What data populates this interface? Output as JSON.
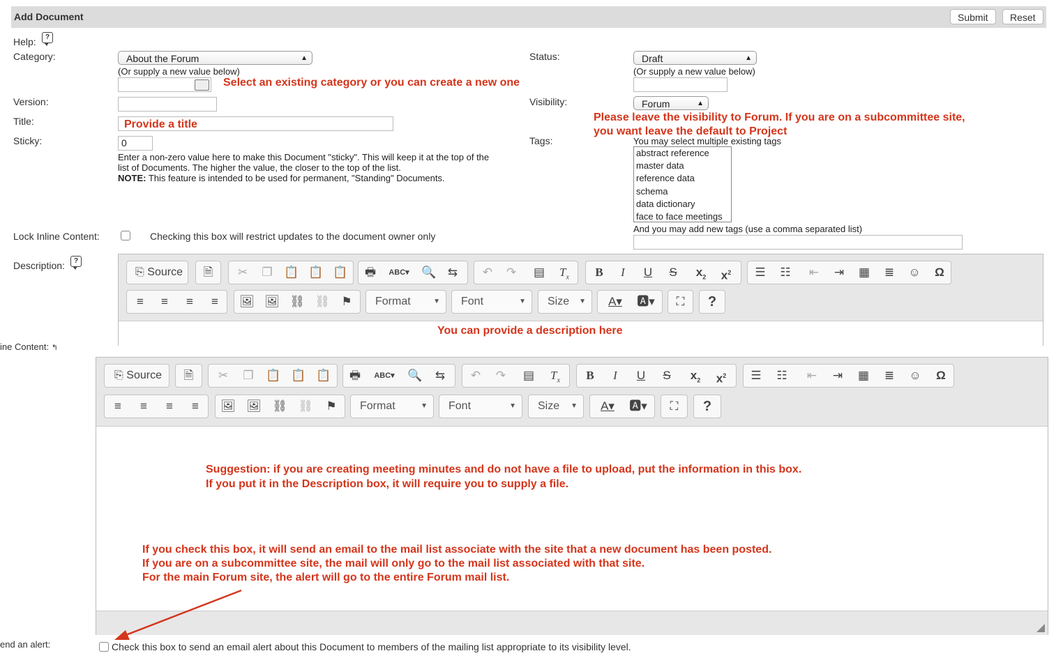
{
  "header": {
    "title": "Add Document",
    "submit_label": "Submit",
    "reset_label": "Reset"
  },
  "form": {
    "help_label": "Help:",
    "category_label": "Category:",
    "category_value": "About the Forum",
    "supply_new_text": "(Or supply a new value below)",
    "version_label": "Version:",
    "title_label": "Title:",
    "sticky_label": "Sticky:",
    "sticky_value": "0",
    "sticky_help_line1": "Enter a non-zero value here to make this Document \"sticky\". This will keep it at the top of the",
    "sticky_help_line2": "list of Documents. The higher the value, the closer to the top of the list.",
    "note_bold": "NOTE:",
    "note_text": " This feature is intended to be used for permanent, \"Standing\" Documents.",
    "status_label": "Status:",
    "status_value": "Draft",
    "status_supply_text": "(Or supply a new value below)",
    "visibility_label": "Visibility:",
    "visibility_value": "Forum",
    "tags_label": "Tags:",
    "tags_hint": "You may select multiple existing tags",
    "tags": [
      "abstract reference",
      "master data",
      "reference data",
      "schema",
      "data dictionary",
      "face to face meetings"
    ],
    "tags_add_hint": "And you may add new tags (use a comma separated list)",
    "lock_label": "Lock Inline Content:",
    "lock_text": "Checking this box will restrict updates to the document owner only",
    "description_label": "Description:",
    "inline_content_label_partial": "ine Content:",
    "alert_label_partial": "end an alert:",
    "alert_text": "Check this box to send an email alert about this Document to members of the mailing list appropriate to its visibility level."
  },
  "toolbar": {
    "source_label": "Source",
    "format_label": "Format",
    "font_label": "Font",
    "size_label": "Size"
  },
  "annotations": {
    "category_note": "Select an existing category or you can create a new one",
    "title_note": "Provide a title",
    "visibility_note_line1": "Please leave the visibility to Forum. If you are on a subcommittee site,",
    "visibility_note_line2": "you want leave the default to Project",
    "description_note": "You can provide a description here",
    "inline_note_line1": "Suggestion: if you are creating meeting minutes and do not have a file to upload, put the information in this box.",
    "inline_note_line2": "If you put it in the Description box, it will require you to supply a file.",
    "alert_note_line1": "If you check this box, it will send an email to the mail list associate with the site that a new document has been posted.",
    "alert_note_line2": "If you are on a subcommittee site, the mail will only go to the mail list associated with that site.",
    "alert_note_line3": "For the main Forum site, the alert will go to the entire Forum mail list."
  },
  "colors": {
    "annotation": "#d4361c",
    "header_bg": "#dcdcdc",
    "toolbar_bg": "#e7e7e7"
  }
}
